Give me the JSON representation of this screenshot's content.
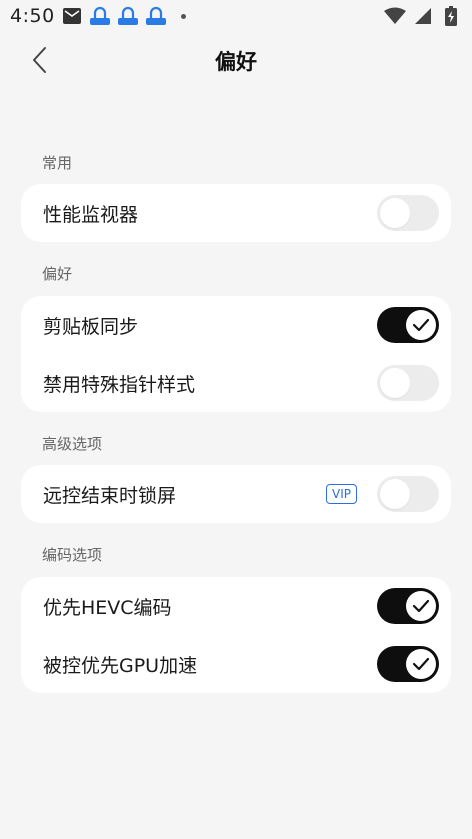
{
  "status_bar": {
    "time": "4:50",
    "icons": [
      "mail-icon",
      "app-notification-icon",
      "app-notification-icon",
      "app-notification-icon"
    ],
    "right_icons": [
      "wifi-icon",
      "signal-icon",
      "battery-charging-icon"
    ]
  },
  "header": {
    "title": "偏好",
    "back_icon": "chevron-left-icon"
  },
  "sections": {
    "common": {
      "label": "常用",
      "items": [
        {
          "label": "性能监视器",
          "enabled": false
        }
      ]
    },
    "preferences": {
      "label": "偏好",
      "items": [
        {
          "label": "剪贴板同步",
          "enabled": true
        },
        {
          "label": "禁用特殊指针样式",
          "enabled": false
        }
      ]
    },
    "advanced": {
      "label": "高级选项",
      "items": [
        {
          "label": "远控结束时锁屏",
          "badge": "VIP",
          "enabled": false
        }
      ]
    },
    "encoding": {
      "label": "编码选项",
      "items": [
        {
          "label": "优先HEVC编码",
          "enabled": true
        },
        {
          "label": "被控优先GPU加速",
          "enabled": true
        }
      ]
    }
  },
  "colors": {
    "toggle_on": "#0e0e0e",
    "toggle_off": "#ececec",
    "vip": "#2b6fe0",
    "background": "#f5f5f5"
  }
}
